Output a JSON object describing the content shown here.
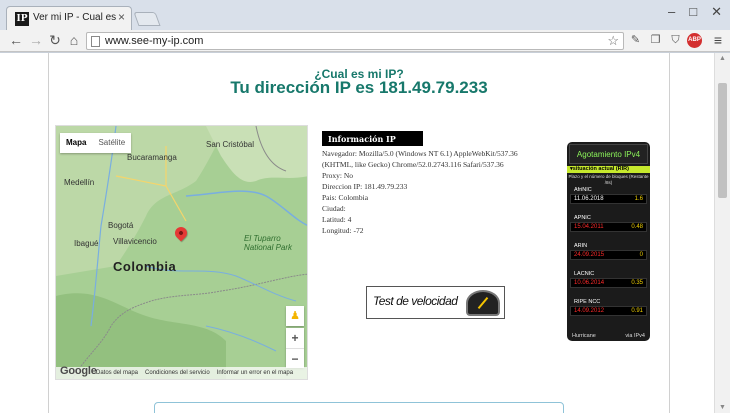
{
  "browser": {
    "tab_title": "Ver mi IP - Cual es mi IP - Direcci",
    "favicon_text": "IP",
    "url": "www.see-my-ip.com",
    "abp_label": "ABP",
    "icons": [
      "back-arrow-icon",
      "forward-arrow-icon",
      "reload-icon",
      "home-icon",
      "page-icon",
      "star-icon",
      "menu-icon"
    ]
  },
  "header": {
    "question": "¿Cual es mi IP?",
    "ip_line": "Tu dirección IP es 181.49.79.233"
  },
  "map": {
    "tabs": [
      "Mapa",
      "Satélite"
    ],
    "active_tab": "Mapa",
    "labels": {
      "san_cristobal": "San Cristóbal",
      "bucaramanga": "Bucaramanga",
      "medellin": "Medellín",
      "bogota": "Bogotá",
      "ibague": "Ibagué",
      "villavicencio": "Villavicencio",
      "colombia": "Colombia",
      "park": "El Tuparro\nNational Park"
    },
    "zoom_in": "+",
    "zoom_out": "−",
    "google": "Google",
    "footer": [
      "Datos del mapa",
      "Condiciones del servicio",
      "Informar un error en el mapa"
    ]
  },
  "info": {
    "title": "Información IP",
    "lines": [
      "Navegador: Mozilla/5.0 (Windows NT 6.1) AppleWebKit/537.36",
      "(KHTML, like Gecko) Chrome/52.0.2743.116 Safari/537.36",
      "Proxy: No",
      "Direccion IP: 181.49.79.233",
      "Pais: Colombia",
      "Ciudad:",
      "Latitud: 4",
      "Longitud: -72"
    ]
  },
  "speed_test": {
    "label": "Test de velocidad"
  },
  "ipv4": {
    "title": "Agotamiento IPv4",
    "subtitle": "▾situación actual (RIR)",
    "note": "Plazo y el número de bloques (Restante /8s)",
    "rirs": [
      {
        "name": "AfriNIC",
        "date": "11.06.2018",
        "value": "1.6",
        "date_color": "#ffffff",
        "value_color": "#f0d000"
      },
      {
        "name": "APNIC",
        "date": "15.04.2011",
        "value": "0.48",
        "date_color": "#ff2a2a",
        "value_color": "#f0d000"
      },
      {
        "name": "ARIN",
        "date": "24.09.2015",
        "value": "0",
        "date_color": "#ff2a2a",
        "value_color": "#f0d000"
      },
      {
        "name": "LACNIC",
        "date": "10.06.2014",
        "value": "0.35",
        "date_color": "#ff2a2a",
        "value_color": "#f0d000"
      },
      {
        "name": "RIPE NCC",
        "date": "14.09.2012",
        "value": "0.91",
        "date_color": "#ff2a2a",
        "value_color": "#f0d000"
      }
    ],
    "footer_left": "Hurricane",
    "footer_right": "via IPv4"
  },
  "colors": {
    "accent": "#17786b"
  }
}
